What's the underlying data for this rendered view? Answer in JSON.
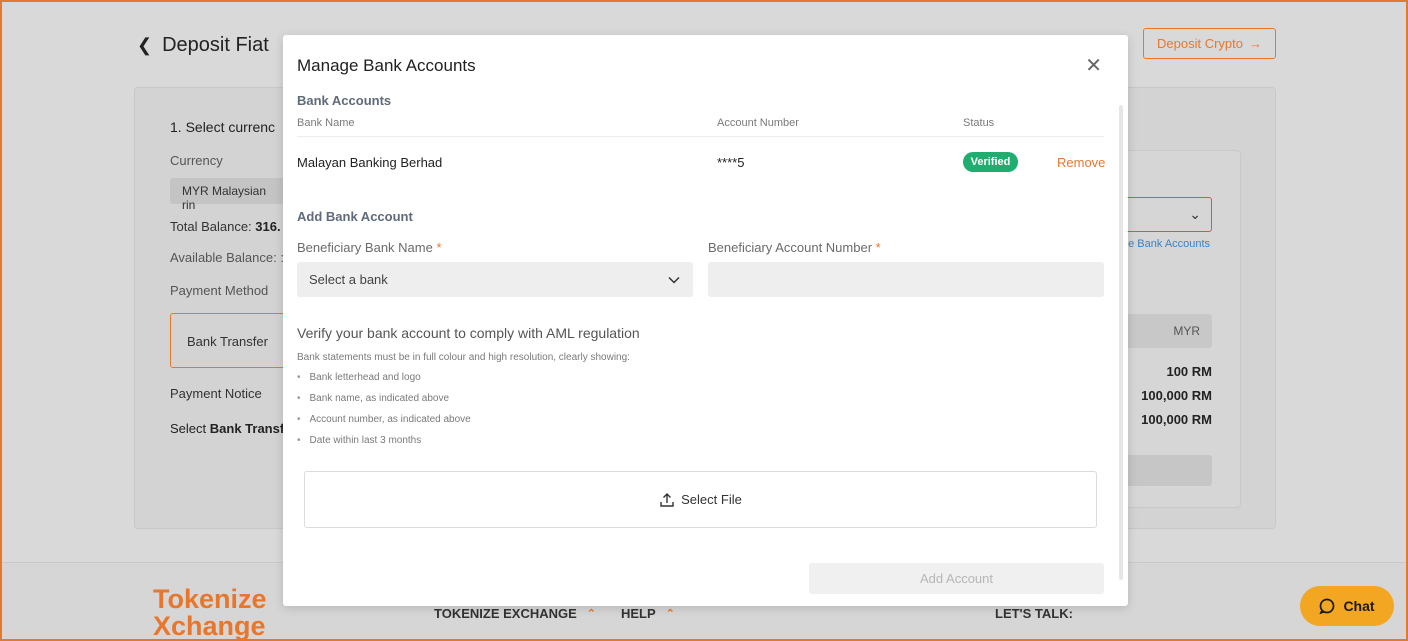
{
  "page": {
    "title": "Deposit Fiat",
    "deposit_crypto_label": "Deposit Crypto",
    "section1_title": "1. Select currenc",
    "currency_label": "Currency",
    "currency_value": "MYR Malaysian rin",
    "total_balance_label": "Total Balance:",
    "total_balance_value": "316.",
    "available_balance_label": "Available Balance:",
    "available_balance_value": ":",
    "payment_method_label": "Payment Method",
    "payment_method_value": "Bank Transfer",
    "payment_notice_label": "Payment Notice",
    "select_text": "Select",
    "bank_transfer_text": "Bank Transfe",
    "manage_link": "ge Bank Accounts",
    "currency_code": "MYR",
    "amount_1": "100 RM",
    "amount_2": "100,000 RM",
    "amount_3": "100,000 RM"
  },
  "footer": {
    "logo_line1": "Tokenize",
    "logo_line2": "Xchange",
    "link_exchange": "TOKENIZE EXCHANGE",
    "link_help": "HELP",
    "link_talk": "LET'S TALK:",
    "chat_label": "Chat"
  },
  "modal": {
    "title": "Manage Bank Accounts",
    "bank_accounts_heading": "Bank Accounts",
    "columns": [
      "Bank Name",
      "Account Number",
      "Status"
    ],
    "accounts": [
      {
        "bank_name": "Malayan Banking Berhad",
        "account_number": "****5",
        "status": "Verified",
        "action": "Remove"
      }
    ],
    "add_heading": "Add Bank Account",
    "bank_name_label": "Beneficiary Bank Name",
    "account_number_label": "Beneficiary Account Number",
    "required_mark": "*",
    "bank_select_placeholder": "Select a bank",
    "verify_heading": "Verify your bank account to comply with AML regulation",
    "verify_sub": "Bank statements must be in full colour and high resolution, clearly showing:",
    "requirements": [
      "Bank letterhead and logo",
      "Bank name, as indicated above",
      "Account number, as indicated above",
      "Date within last 3 months"
    ],
    "select_file_label": "Select File",
    "add_account_label": "Add Account"
  },
  "colors": {
    "accent": "#e8772e",
    "verified": "#1fae6f",
    "chat": "#f2a622"
  }
}
